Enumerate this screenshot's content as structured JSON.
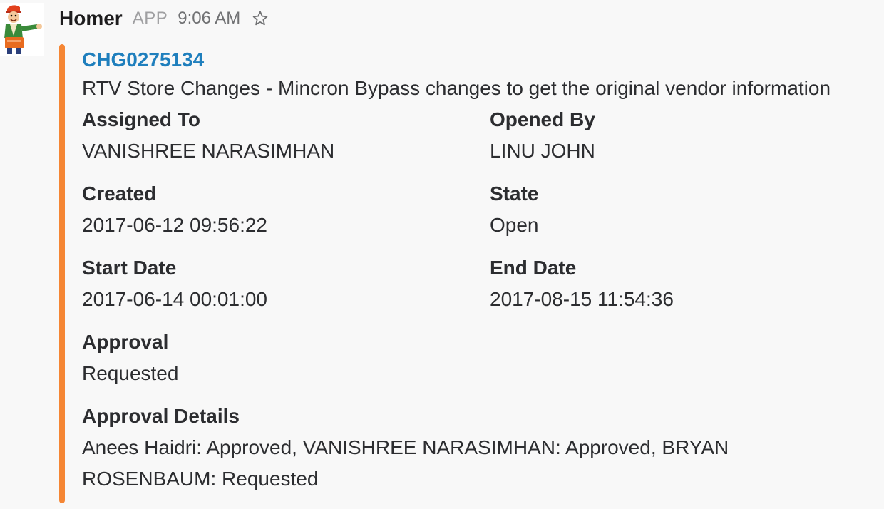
{
  "message": {
    "sender": "Homer",
    "badge": "APP",
    "time": "9:06 AM",
    "star_icon": "star-outline-icon",
    "avatar_icon": "homer-mascot-avatar"
  },
  "attachment": {
    "accent_color": "#f58634",
    "link_color": "#1f7fbd",
    "title": "CHG0275134",
    "description": "RTV Store Changes - Mincron Bypass changes to get the original vendor information",
    "fields": {
      "assigned_to": {
        "title": "Assigned To",
        "value": "VANISHREE NARASIMHAN"
      },
      "opened_by": {
        "title": "Opened By",
        "value": "LINU JOHN"
      },
      "created": {
        "title": "Created",
        "value": "2017-06-12 09:56:22"
      },
      "state": {
        "title": "State",
        "value": "Open"
      },
      "start_date": {
        "title": "Start Date",
        "value": "2017-06-14 00:01:00"
      },
      "end_date": {
        "title": "End Date",
        "value": "2017-08-15 11:54:36"
      },
      "approval": {
        "title": "Approval",
        "value": "Requested"
      },
      "approval_details": {
        "title": "Approval Details",
        "value_line1": "Anees Haidri: Approved, VANISHREE NARASIMHAN: Approved, BRYAN",
        "value_line2": "ROSENBAUM: Requested"
      }
    }
  }
}
